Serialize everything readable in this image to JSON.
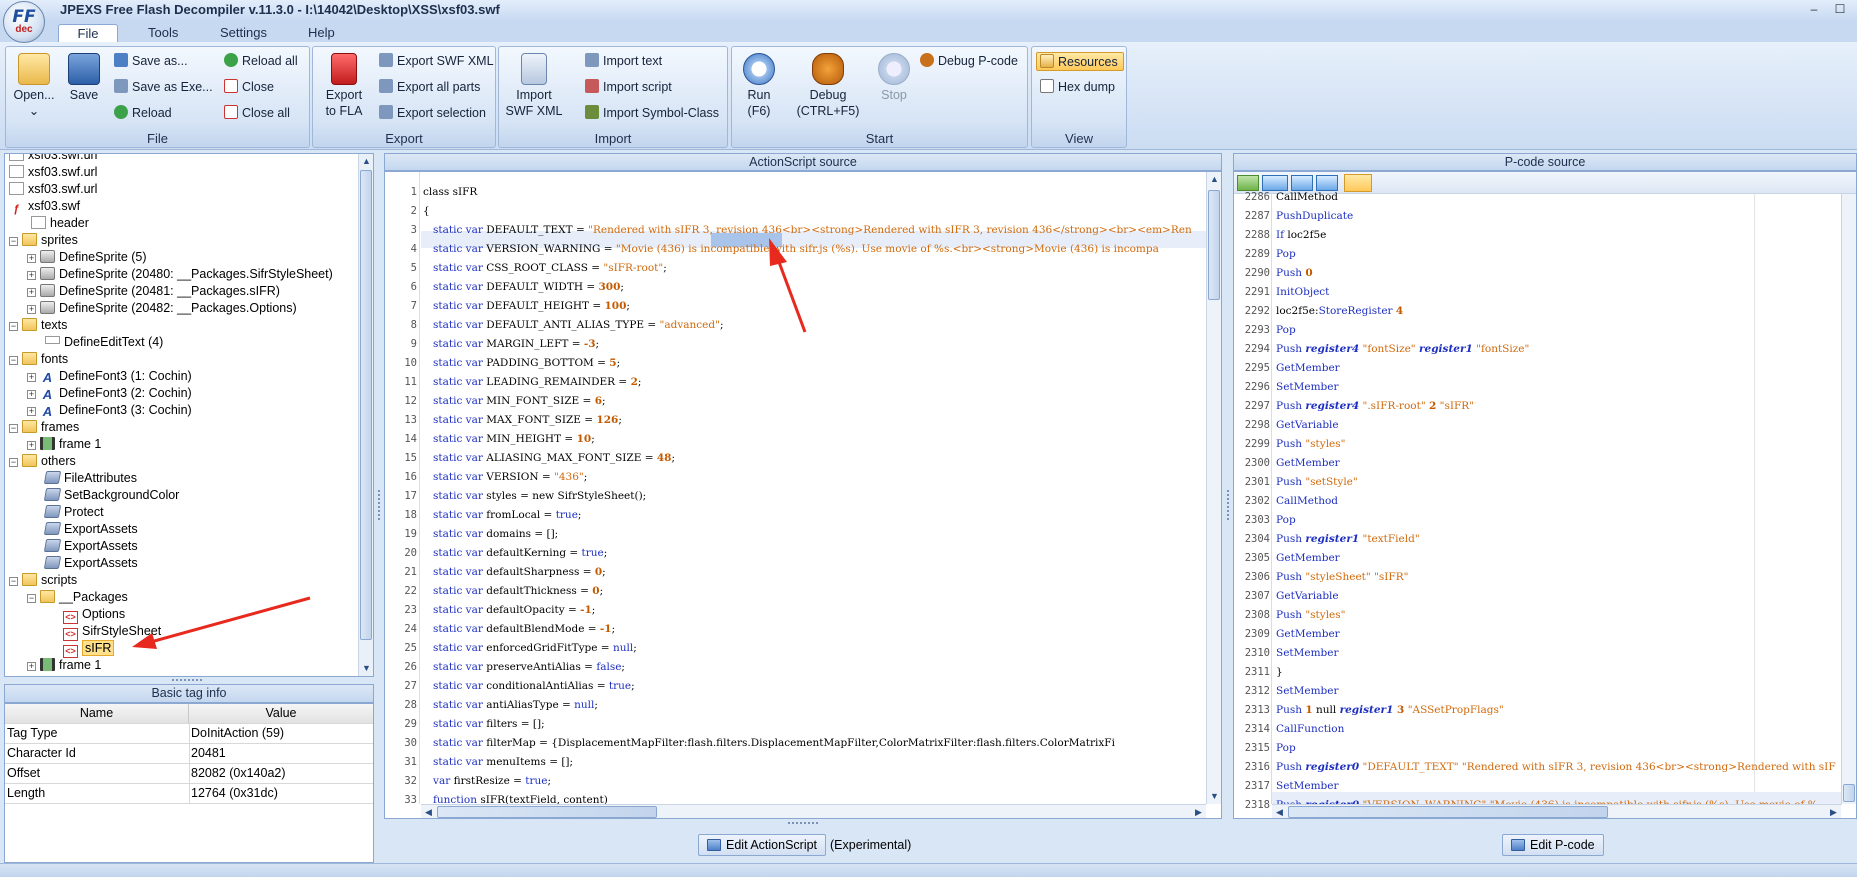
{
  "window": {
    "title": "JPEXS Free Flash Decompiler v.11.3.0 - I:\\14042\\Desktop\\XSS\\xsf03.swf",
    "logo_main": "FF",
    "logo_sub": "dec",
    "minimize": "–",
    "maximize": "☐"
  },
  "menu_tabs": [
    "File",
    "Tools",
    "Settings",
    "Help"
  ],
  "ribbon": {
    "file": {
      "label": "File",
      "open": "Open...",
      "save": "Save",
      "save_as": "Save as...",
      "save_as_exe": "Save as Exe...",
      "reload": "Reload",
      "reload_all": "Reload all",
      "close": "Close",
      "close_all": "Close all"
    },
    "export": {
      "label": "Export",
      "export_to_fla_1": "Export",
      "export_to_fla_2": "to FLA",
      "export_swf_xml": "Export SWF XML",
      "export_all_parts": "Export all parts",
      "export_selection": "Export selection"
    },
    "import": {
      "label": "Import",
      "import_swf_xml_1": "Import",
      "import_swf_xml_2": "SWF XML",
      "import_text": "Import text",
      "import_script": "Import script",
      "import_symbol_class": "Import Symbol-Class"
    },
    "start": {
      "label": "Start",
      "run_1": "Run",
      "run_2": "(F6)",
      "debug_1": "Debug",
      "debug_2": "(CTRL+F5)",
      "stop": "Stop",
      "debug_pcode": "Debug P-code"
    },
    "view": {
      "label": "View",
      "resources": "Resources",
      "hex_dump": "Hex dump"
    }
  },
  "tree": {
    "items": [
      "xsf03.swf.url",
      "xsf03.swf.url",
      "xsf03.swf.url",
      "xsf03.swf",
      "header",
      "sprites",
      "DefineSprite (5)",
      "DefineSprite (20480: __Packages.SifrStyleSheet)",
      "DefineSprite (20481: __Packages.sIFR)",
      "DefineSprite (20482: __Packages.Options)",
      "texts",
      "DefineEditText (4)",
      "fonts",
      "DefineFont3 (1: Cochin)",
      "DefineFont3 (2: Cochin)",
      "DefineFont3 (3: Cochin)",
      "frames",
      "frame 1",
      "others",
      "FileAttributes",
      "SetBackgroundColor",
      "Protect",
      "ExportAssets",
      "ExportAssets",
      "ExportAssets",
      "scripts",
      "__Packages",
      "Options",
      "SifrStyleSheet",
      "sIFR",
      "frame 1"
    ]
  },
  "basic_tag_info": {
    "title": "Basic tag info",
    "columns": [
      "Name",
      "Value"
    ],
    "rows": [
      [
        "Tag Type",
        "DoInitAction (59)"
      ],
      [
        "Character Id",
        "20481"
      ],
      [
        "Offset",
        "82082 (0x140a2)"
      ],
      [
        "Length",
        "12764 (0x31dc)"
      ]
    ]
  },
  "actionscript": {
    "title": "ActionScript source",
    "edit_button": "Edit ActionScript",
    "experimental": "(Experimental)",
    "line_numbers": [
      "1",
      "2",
      "3",
      "4",
      "5",
      "6",
      "7",
      "8",
      "9",
      "10",
      "11",
      "12",
      "13",
      "14",
      "15",
      "16",
      "17",
      "18",
      "19",
      "20",
      "21",
      "22",
      "23",
      "24",
      "25",
      "26",
      "27",
      "28",
      "29",
      "30",
      "31",
      "32",
      "33"
    ],
    "lines": [
      [
        [
          "",
          "class sIFR"
        ]
      ],
      [
        [
          "",
          "{"
        ]
      ],
      [
        [
          "kw",
          "   static var "
        ],
        [
          "",
          "DEFAULT_TEXT = "
        ],
        [
          "str",
          "\"Rendered with sIFR 3, revision 436<br><strong>Rendered with sIFR 3, revision 436</strong><br><em>Ren"
        ]
      ],
      [
        [
          "kw",
          "   static var "
        ],
        [
          "",
          "VERSION_WARNING = "
        ],
        [
          "str",
          "\"Movie (436) is incompatible with sifr.js (%s). Use movie of %s.<br><strong>Movie (436) is incompa"
        ]
      ],
      [
        [
          "kw",
          "   static var "
        ],
        [
          "",
          "CSS_ROOT_CLASS = "
        ],
        [
          "str",
          "\"sIFR-root\""
        ],
        [
          "",
          ";"
        ]
      ],
      [
        [
          "kw",
          "   static var "
        ],
        [
          "",
          "DEFAULT_WIDTH = "
        ],
        [
          "num",
          "300"
        ],
        [
          "",
          ";"
        ]
      ],
      [
        [
          "kw",
          "   static var "
        ],
        [
          "",
          "DEFAULT_HEIGHT = "
        ],
        [
          "num",
          "100"
        ],
        [
          "",
          ";"
        ]
      ],
      [
        [
          "kw",
          "   static var "
        ],
        [
          "",
          "DEFAULT_ANTI_ALIAS_TYPE = "
        ],
        [
          "str",
          "\"advanced\""
        ],
        [
          "",
          ";"
        ]
      ],
      [
        [
          "kw",
          "   static var "
        ],
        [
          "",
          "MARGIN_LEFT = "
        ],
        [
          "num",
          "-3"
        ],
        [
          "",
          ";"
        ]
      ],
      [
        [
          "kw",
          "   static var "
        ],
        [
          "",
          "PADDING_BOTTOM = "
        ],
        [
          "num",
          "5"
        ],
        [
          "",
          ";"
        ]
      ],
      [
        [
          "kw",
          "   static var "
        ],
        [
          "",
          "LEADING_REMAINDER = "
        ],
        [
          "num",
          "2"
        ],
        [
          "",
          ";"
        ]
      ],
      [
        [
          "kw",
          "   static var "
        ],
        [
          "",
          "MIN_FONT_SIZE = "
        ],
        [
          "num",
          "6"
        ],
        [
          "",
          ";"
        ]
      ],
      [
        [
          "kw",
          "   static var "
        ],
        [
          "",
          "MAX_FONT_SIZE = "
        ],
        [
          "num",
          "126"
        ],
        [
          "",
          ";"
        ]
      ],
      [
        [
          "kw",
          "   static var "
        ],
        [
          "",
          "MIN_HEIGHT = "
        ],
        [
          "num",
          "10"
        ],
        [
          "",
          ";"
        ]
      ],
      [
        [
          "kw",
          "   static var "
        ],
        [
          "",
          "ALIASING_MAX_FONT_SIZE = "
        ],
        [
          "num",
          "48"
        ],
        [
          "",
          ";"
        ]
      ],
      [
        [
          "kw",
          "   static var "
        ],
        [
          "",
          "VERSION = "
        ],
        [
          "str",
          "\"436\""
        ],
        [
          "",
          ";"
        ]
      ],
      [
        [
          "kw",
          "   static var "
        ],
        [
          "",
          "styles = new SifrStyleSheet();"
        ]
      ],
      [
        [
          "kw",
          "   static var "
        ],
        [
          "",
          "fromLocal = "
        ],
        [
          "nl",
          "true"
        ],
        [
          "",
          ";"
        ]
      ],
      [
        [
          "kw",
          "   static var "
        ],
        [
          "",
          "domains = [];"
        ]
      ],
      [
        [
          "kw",
          "   static var "
        ],
        [
          "",
          "defaultKerning = "
        ],
        [
          "nl",
          "true"
        ],
        [
          "",
          ";"
        ]
      ],
      [
        [
          "kw",
          "   static var "
        ],
        [
          "",
          "defaultSharpness = "
        ],
        [
          "num",
          "0"
        ],
        [
          "",
          ";"
        ]
      ],
      [
        [
          "kw",
          "   static var "
        ],
        [
          "",
          "defaultThickness = "
        ],
        [
          "num",
          "0"
        ],
        [
          "",
          ";"
        ]
      ],
      [
        [
          "kw",
          "   static var "
        ],
        [
          "",
          "defaultOpacity = "
        ],
        [
          "num",
          "-1"
        ],
        [
          "",
          ";"
        ]
      ],
      [
        [
          "kw",
          "   static var "
        ],
        [
          "",
          "defaultBlendMode = "
        ],
        [
          "num",
          "-1"
        ],
        [
          "",
          ";"
        ]
      ],
      [
        [
          "kw",
          "   static var "
        ],
        [
          "",
          "enforcedGridFitType = "
        ],
        [
          "nl",
          "null"
        ],
        [
          "",
          ";"
        ]
      ],
      [
        [
          "kw",
          "   static var "
        ],
        [
          "",
          "preserveAntiAlias = "
        ],
        [
          "nl",
          "false"
        ],
        [
          "",
          ";"
        ]
      ],
      [
        [
          "kw",
          "   static var "
        ],
        [
          "",
          "conditionalAntiAlias = "
        ],
        [
          "nl",
          "true"
        ],
        [
          "",
          ";"
        ]
      ],
      [
        [
          "kw",
          "   static var "
        ],
        [
          "",
          "antiAliasType = "
        ],
        [
          "nl",
          "null"
        ],
        [
          "",
          ";"
        ]
      ],
      [
        [
          "kw",
          "   static var "
        ],
        [
          "",
          "filters = [];"
        ]
      ],
      [
        [
          "kw",
          "   static var "
        ],
        [
          "",
          "filterMap = {DisplacementMapFilter:flash.filters.DisplacementMapFilter,ColorMatrixFilter:flash.filters.ColorMatrixFi"
        ]
      ],
      [
        [
          "kw",
          "   static var "
        ],
        [
          "",
          "menuItems = [];"
        ]
      ],
      [
        [
          "kw",
          "   var "
        ],
        [
          "",
          "firstResize = "
        ],
        [
          "nl",
          "true"
        ],
        [
          "",
          ";"
        ]
      ],
      [
        [
          "kw",
          "   function "
        ],
        [
          "",
          "sIFR(textField, content)"
        ]
      ]
    ]
  },
  "pcode": {
    "title": "P-code source",
    "edit_button": "Edit P-code",
    "toolbar_icons": [
      "graph-icon",
      "deobfuscate-off-icon",
      "hex-icon",
      "resolve-constants-icon",
      "settings-icon"
    ],
    "line_numbers": [
      "2286",
      "2287",
      "2288",
      "2289",
      "2290",
      "2291",
      "2292",
      "2293",
      "2294",
      "2295",
      "2296",
      "2297",
      "2298",
      "2299",
      "2300",
      "2301",
      "2302",
      "2303",
      "2304",
      "2305",
      "2306",
      "2307",
      "2308",
      "2309",
      "2310",
      "2311",
      "2312",
      "2313",
      "2314",
      "2315",
      "2316",
      "2317",
      "2318"
    ],
    "lines": [
      [
        [
          "k",
          "CallMethod"
        ]
      ],
      [
        [
          "",
          "PushDuplicate"
        ]
      ],
      [
        [
          "",
          "If "
        ],
        [
          "k",
          "loc2f5e"
        ]
      ],
      [
        [
          "",
          "Pop"
        ]
      ],
      [
        [
          "",
          "Push "
        ],
        [
          "n",
          "0"
        ]
      ],
      [
        [
          "",
          "InitObject"
        ]
      ],
      [
        [
          "k",
          "loc2f5e:"
        ],
        [
          "",
          "StoreRegister "
        ],
        [
          "n",
          "4"
        ]
      ],
      [
        [
          "",
          "Pop"
        ]
      ],
      [
        [
          "",
          "Push "
        ],
        [
          "reg",
          "register4"
        ],
        [
          "s",
          " \"fontSize\" "
        ],
        [
          "reg",
          "register1"
        ],
        [
          "s",
          " \"fontSize\""
        ]
      ],
      [
        [
          "",
          "GetMember"
        ]
      ],
      [
        [
          "",
          "SetMember"
        ]
      ],
      [
        [
          "",
          "Push "
        ],
        [
          "reg",
          "register4"
        ],
        [
          "s",
          " \".sIFR-root\" "
        ],
        [
          "n",
          "2"
        ],
        [
          "s",
          " \"sIFR\""
        ]
      ],
      [
        [
          "",
          "GetVariable"
        ]
      ],
      [
        [
          "",
          "Push "
        ],
        [
          "s",
          "\"styles\""
        ]
      ],
      [
        [
          "",
          "GetMember"
        ]
      ],
      [
        [
          "",
          "Push "
        ],
        [
          "s",
          "\"setStyle\""
        ]
      ],
      [
        [
          "",
          "CallMethod"
        ]
      ],
      [
        [
          "",
          "Pop"
        ]
      ],
      [
        [
          "",
          "Push "
        ],
        [
          "reg",
          "register1"
        ],
        [
          "s",
          " \"textField\""
        ]
      ],
      [
        [
          "",
          "GetMember"
        ]
      ],
      [
        [
          "",
          "Push "
        ],
        [
          "s",
          "\"styleSheet\" \"sIFR\""
        ]
      ],
      [
        [
          "",
          "GetVariable"
        ]
      ],
      [
        [
          "",
          "Push "
        ],
        [
          "s",
          "\"styles\""
        ]
      ],
      [
        [
          "",
          "GetMember"
        ]
      ],
      [
        [
          "",
          "SetMember"
        ]
      ],
      [
        [
          "k",
          "}"
        ]
      ],
      [
        [
          "",
          "SetMember"
        ]
      ],
      [
        [
          "",
          "Push "
        ],
        [
          "n",
          "1"
        ],
        [
          "k",
          " null "
        ],
        [
          "reg",
          "register1"
        ],
        [
          "n",
          " 3"
        ],
        [
          "s",
          " \"ASSetPropFlags\""
        ]
      ],
      [
        [
          "",
          "CallFunction"
        ]
      ],
      [
        [
          "",
          "Pop"
        ]
      ],
      [
        [
          "",
          "Push "
        ],
        [
          "reg",
          "register0"
        ],
        [
          "s",
          " \"DEFAULT_TEXT\" \"Rendered with sIFR 3, revision 436<br><strong>Rendered with sIF"
        ]
      ],
      [
        [
          "",
          "SetMember"
        ]
      ],
      [
        [
          "",
          "Push "
        ],
        [
          "reg",
          "register0"
        ],
        [
          "s",
          " \"VERSION_WARNING\" \"Movie (436) is incompatible with sifr.js (%s). Use movie of %"
        ]
      ]
    ]
  }
}
